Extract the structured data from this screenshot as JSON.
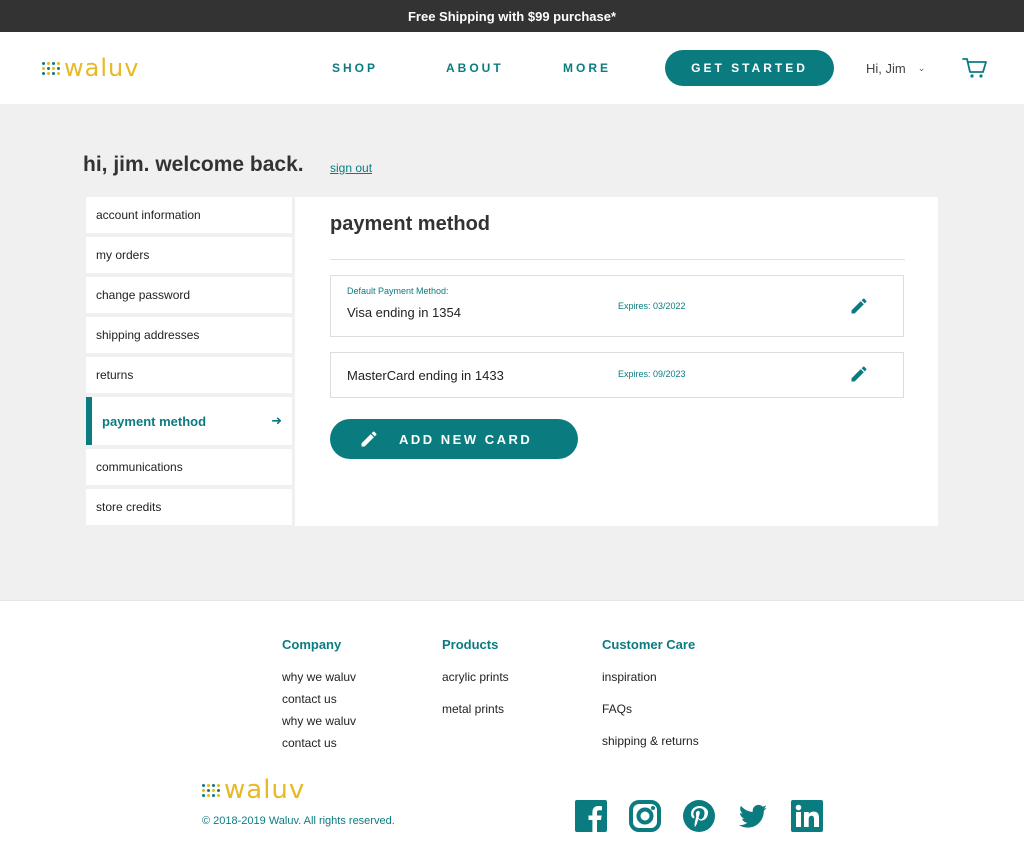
{
  "promo": {
    "text": "Free Shipping with $99 purchase*"
  },
  "brand": {
    "name": "waluv",
    "colors": {
      "teal": "#0a7c80",
      "gold": "#e8b923",
      "dark": "#333333"
    }
  },
  "nav": {
    "items": [
      {
        "label": "SHOP"
      },
      {
        "label": "ABOUT"
      },
      {
        "label": "MORE"
      }
    ],
    "cta": "GET STARTED"
  },
  "user": {
    "greeting": "Hi, Jim",
    "dropdown_icon": "chevron-down-icon",
    "cart_icon": "cart-icon"
  },
  "account": {
    "welcome": "hi, jim. welcome back.",
    "signout": "sign out",
    "sidebar": [
      {
        "label": "account information"
      },
      {
        "label": "my orders"
      },
      {
        "label": "change password"
      },
      {
        "label": "shipping addresses"
      },
      {
        "label": "returns"
      },
      {
        "label": "payment method",
        "active": true
      },
      {
        "label": "communications"
      },
      {
        "label": "store credits"
      }
    ],
    "active_arrow_icon": "arrow-right-icon"
  },
  "payment": {
    "title": "payment method",
    "cards": [
      {
        "default_label": "Default Payment Method:",
        "name": "Visa ending in 1354",
        "expires": "Expires: 03/2022"
      },
      {
        "name": "MasterCard ending in 1433",
        "expires": "Expires: 09/2023"
      }
    ],
    "add_button": "ADD NEW CARD"
  },
  "footer": {
    "columns": [
      {
        "heading": "Company",
        "links": [
          "why we waluv",
          "contact us",
          "why we waluv",
          "contact us"
        ]
      },
      {
        "heading": "Products",
        "links": [
          "acrylic prints",
          "metal prints"
        ]
      },
      {
        "heading": "Customer Care",
        "links": [
          "inspiration",
          "FAQs",
          "shipping & returns"
        ]
      }
    ],
    "copyright": "© 2018-2019 Waluv. All rights reserved.",
    "social": [
      "facebook-icon",
      "instagram-icon",
      "pinterest-icon",
      "twitter-icon",
      "linkedin-icon"
    ]
  }
}
